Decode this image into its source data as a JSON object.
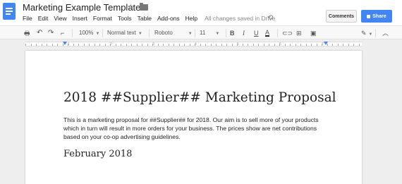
{
  "header": {
    "title": "Marketing Example Template",
    "star": "☆",
    "history_icon": "⟲",
    "comments_label": "Comments",
    "share_label": "Share"
  },
  "menu": [
    "File",
    "Edit",
    "View",
    "Insert",
    "Format",
    "Tools",
    "Table",
    "Add-ons",
    "Help"
  ],
  "save_status": "All changes saved in Drive",
  "toolbar": {
    "zoom": "100%",
    "style": "Normal text",
    "font": "Roboto",
    "size": "11",
    "bold": "B",
    "italic": "I",
    "underline": "U",
    "text_color": "A"
  },
  "ruler": {
    "numbers": [
      "1",
      "1",
      "2",
      "3",
      "4",
      "5",
      "6",
      "7"
    ]
  },
  "document": {
    "title": "2018 ##Supplier## Marketing Proposal",
    "body_lines": [
      "This is a marketing proposal for ##Supplier## for 2018. Our aim is to sell more of your products",
      "which in turn will result in more orders for your business. The prices show are net contributions",
      "based on your co-op advertising guidelines."
    ],
    "subheading": "February 2018"
  },
  "colors": {
    "accent": "#4285f4",
    "doc_icon": "#4285f4"
  }
}
